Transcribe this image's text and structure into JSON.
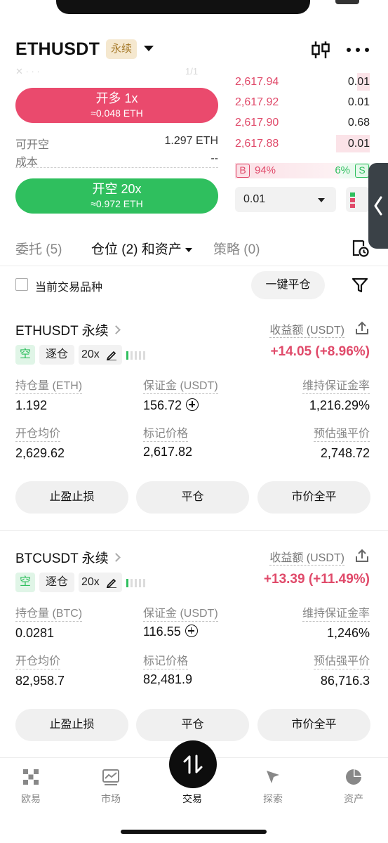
{
  "header": {
    "pair": "ETHUSDT",
    "contract_type": "永续"
  },
  "order_panel": {
    "long_button": {
      "label": "开多 1x",
      "sub": "≈0.048 ETH"
    },
    "short_button": {
      "label": "开空 20x",
      "sub": "≈0.972 ETH"
    },
    "available_short": {
      "label": "可开空",
      "value": "1.297 ETH"
    },
    "cost": {
      "label": "成本",
      "value": "--"
    }
  },
  "order_book": {
    "rows": [
      {
        "price": "2,617.94",
        "qty": "0.01",
        "depth": 0.1
      },
      {
        "price": "2,617.92",
        "qty": "0.01",
        "depth": 0.0
      },
      {
        "price": "2,617.90",
        "qty": "0.68",
        "depth": 0.0
      },
      {
        "price": "2,617.88",
        "qty": "0.01",
        "depth": 0.25
      }
    ],
    "buy_ratio": "94%",
    "sell_ratio": "6%",
    "buy_marker": "B",
    "sell_marker": "S",
    "depth_step": "0.01"
  },
  "tabs": {
    "orders": "委托 (5)",
    "positions": "仓位 (2) 和资产",
    "strategies": "策略 (0)"
  },
  "filter": {
    "current_only": "当前交易品种",
    "close_all": "一键平仓"
  },
  "positions": [
    {
      "title": "ETHUSDT 永续",
      "pnl_label": "收益额 (USDT)",
      "side": "空",
      "margin_mode": "逐仓",
      "leverage": "20x",
      "pnl": "+14.05 (+8.96%)",
      "size_label": "持仓量 (ETH)",
      "size": "1.192",
      "margin_label": "保证金 (USDT)",
      "margin": "156.72",
      "mmr_label": "维持保证金率",
      "mmr": "1,216.29%",
      "entry_label": "开仓均价",
      "entry": "2,629.62",
      "mark_label": "标记价格",
      "mark": "2,617.82",
      "liq_label": "预估强平价",
      "liq": "2,748.72",
      "tpsl": "止盈止损",
      "close": "平仓",
      "market_close": "市价全平"
    },
    {
      "title": "BTCUSDT 永续",
      "pnl_label": "收益额 (USDT)",
      "side": "空",
      "margin_mode": "逐仓",
      "leverage": "20x",
      "pnl": "+13.39 (+11.49%)",
      "size_label": "持仓量 (BTC)",
      "size": "0.0281",
      "margin_label": "保证金 (USDT)",
      "margin": "116.55",
      "mmr_label": "维持保证金率",
      "mmr": "1,246%",
      "entry_label": "开仓均价",
      "entry": "82,958.7",
      "mark_label": "标记价格",
      "mark": "82,481.9",
      "liq_label": "预估强平价",
      "liq": "86,716.3",
      "tpsl": "止盈止损",
      "close": "平仓",
      "market_close": "市价全平"
    }
  ],
  "bottom_nav": {
    "home": "欧易",
    "market": "市场",
    "trade": "交易",
    "explore": "探索",
    "assets": "资产"
  },
  "colors": {
    "long": "#ea4a6d",
    "short": "#2fbf5e",
    "badge": "#f5e8cf"
  }
}
